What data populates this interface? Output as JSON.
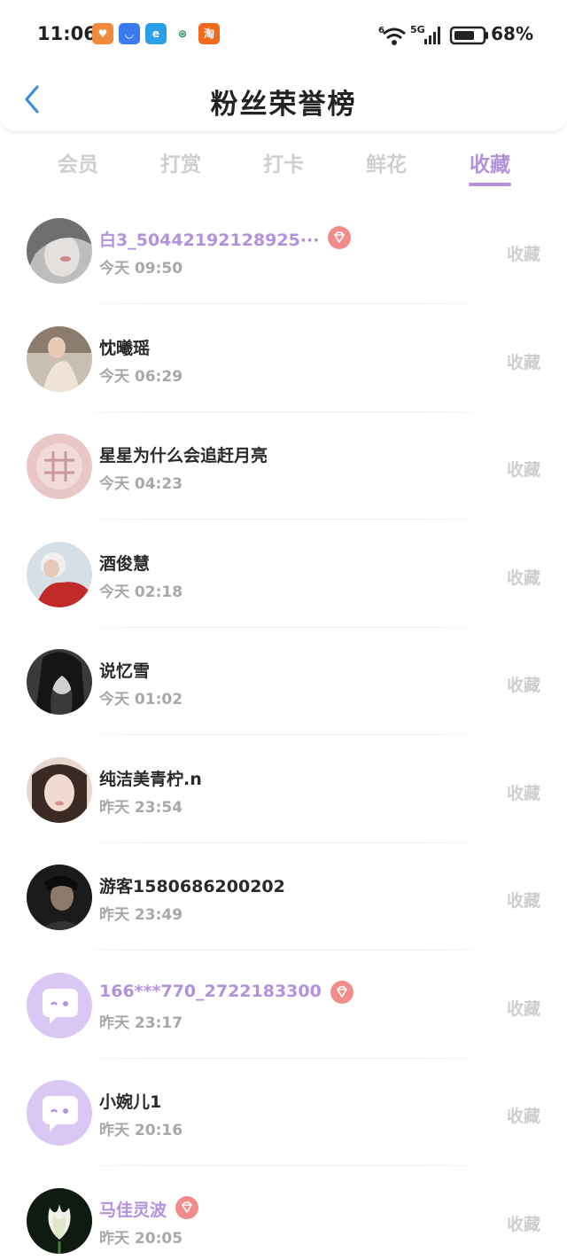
{
  "status_bar": {
    "time": "11:06",
    "battery_percent": "68%",
    "network_label": "5G",
    "wifi_label": "6",
    "app_icons": [
      {
        "name": "heart-app-icon",
        "color": "#f08a3c",
        "glyph": "♥"
      },
      {
        "name": "honor-store-icon",
        "color": "#3a7bef",
        "glyph": "◡"
      },
      {
        "name": "e-app-icon",
        "color": "#2ba0e8",
        "glyph": "e"
      },
      {
        "name": "china-mobile-icon",
        "color": "#ffffff",
        "glyph": "⊛"
      },
      {
        "name": "taobao-icon",
        "color": "#f26a1b",
        "glyph": "淘"
      }
    ]
  },
  "header": {
    "title": "粉丝荣誉榜"
  },
  "tabs": [
    {
      "label": "会员",
      "active": false
    },
    {
      "label": "打赏",
      "active": false
    },
    {
      "label": "打卡",
      "active": false
    },
    {
      "label": "鲜花",
      "active": false
    },
    {
      "label": "收藏",
      "active": true
    }
  ],
  "colors": {
    "accent": "#b392dd",
    "vip_badge": "#f08c8c",
    "muted": "#cfcfcf"
  },
  "fans": [
    {
      "name": "白3_50442192128925···",
      "time": "今天 09:50",
      "action": "收藏",
      "vip": true,
      "avatar": "photo-gray"
    },
    {
      "name": "忱曦瑶",
      "time": "今天 06:29",
      "action": "收藏",
      "vip": false,
      "avatar": "photo-warm"
    },
    {
      "name": "星星为什么会追赶月亮",
      "time": "今天 04:23",
      "action": "收藏",
      "vip": false,
      "avatar": "photo-pink"
    },
    {
      "name": "酒俊慧",
      "time": "今天 02:18",
      "action": "收藏",
      "vip": false,
      "avatar": "photo-red"
    },
    {
      "name": "说忆雪",
      "time": "今天 01:02",
      "action": "收藏",
      "vip": false,
      "avatar": "photo-bw"
    },
    {
      "name": "纯洁美青柠.n",
      "time": "昨天 23:54",
      "action": "收藏",
      "vip": false,
      "avatar": "photo-skin"
    },
    {
      "name": "游客1580686200202",
      "time": "昨天 23:49",
      "action": "收藏",
      "vip": false,
      "avatar": "photo-dark"
    },
    {
      "name": "166***770_2722183300",
      "time": "昨天 23:17",
      "action": "收藏",
      "vip": true,
      "avatar": "default-chat"
    },
    {
      "name": "小婉儿1",
      "time": "昨天 20:16",
      "action": "收藏",
      "vip": false,
      "avatar": "default-chat"
    },
    {
      "name": "马佳灵波",
      "time": "昨天 20:05",
      "action": "收藏",
      "vip": true,
      "avatar": "photo-lotus"
    }
  ]
}
